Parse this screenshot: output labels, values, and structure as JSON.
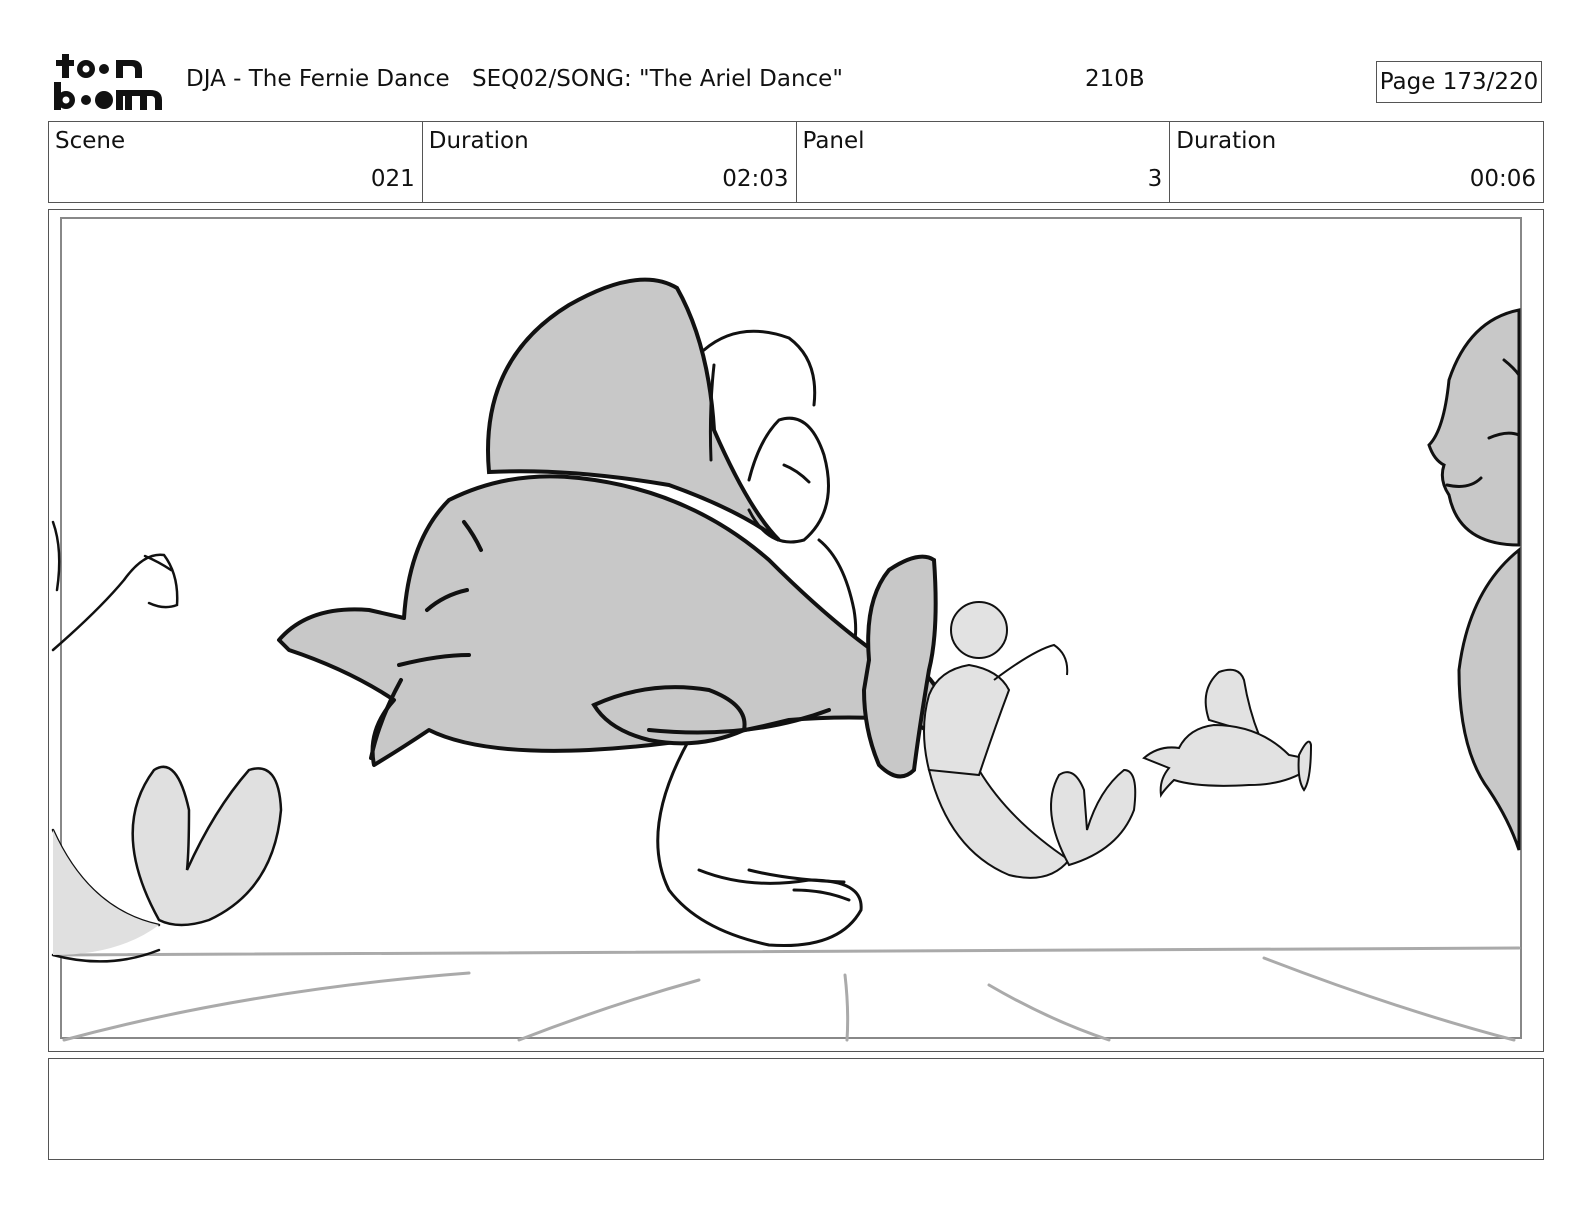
{
  "header": {
    "logo_name": "toonboom-logo",
    "project_title": "DJA - The Fernie Dance",
    "sequence_title": "SEQ02/SONG: \"The Ariel Dance\"",
    "panel_code": "210B",
    "page_label": "Page 173/220"
  },
  "info": {
    "scene_label": "Scene",
    "scene_value": "021",
    "scene_duration_label": "Duration",
    "scene_duration_value": "02:03",
    "panel_label": "Panel",
    "panel_value": "3",
    "panel_duration_label": "Duration",
    "panel_duration_value": "00:06"
  },
  "colors": {
    "fill_gray": "#c8c8c8",
    "light_gray": "#e2e2e2",
    "border": "#555555"
  },
  "notes": {
    "text": ""
  }
}
